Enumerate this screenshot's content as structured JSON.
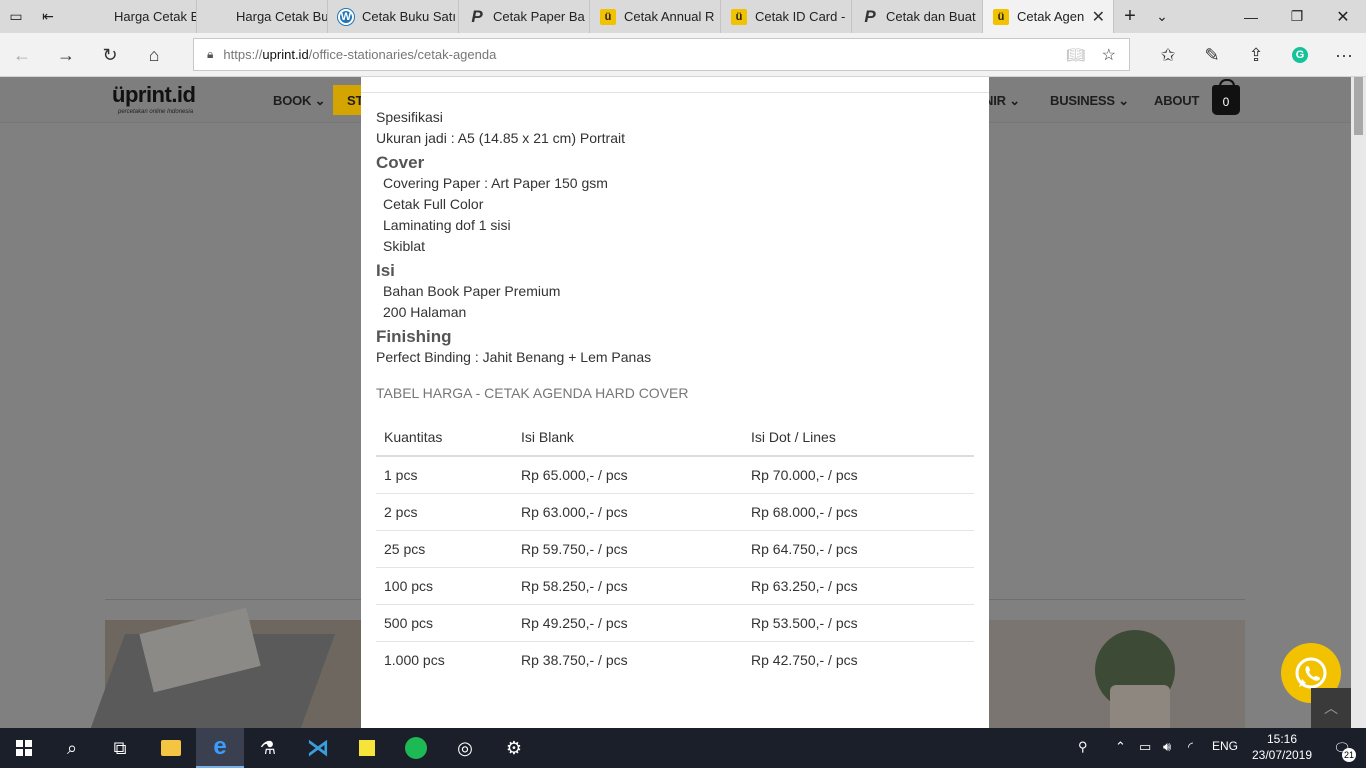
{
  "browser": {
    "tabs": [
      {
        "label": "Harga Cetak Bu",
        "favicon": "blank-icon"
      },
      {
        "label": "Harga Cetak Bu",
        "favicon": "blank-icon"
      },
      {
        "label": "Cetak Buku Satı",
        "favicon": "wordpress-icon"
      },
      {
        "label": "Cetak Paper Ba",
        "favicon": "p-icon"
      },
      {
        "label": "Cetak Annual R",
        "favicon": "uprint-icon"
      },
      {
        "label": "Cetak ID Card -",
        "favicon": "uprint-icon"
      },
      {
        "label": "Cetak dan Buat",
        "favicon": "p-icon"
      },
      {
        "label": "Cetak Agen",
        "favicon": "uprint-icon",
        "active": true
      }
    ],
    "url_prefix": "https://",
    "url_domain": "uprint.id",
    "url_path": "/office-stationaries/cetak-agenda"
  },
  "site": {
    "logo": "üprint.id",
    "tagline": "percetakan online Indonesia",
    "menu": {
      "book": "BOOK ⌄",
      "st": "ST",
      "nir": "NIR ⌄",
      "business": "BUSINESS ⌄",
      "about": "ABOUT"
    },
    "cart_count": "0"
  },
  "modal": {
    "spesifikasi": "Spesifikasi",
    "ukuran": "Ukuran jadi : A5 (14.85 x 21 cm) Portrait",
    "cover_heading": "Cover",
    "cover_items": [
      "Covering Paper : Art Paper 150 gsm",
      "Cetak Full Color",
      "Laminating dof 1 sisi",
      "Skiblat"
    ],
    "isi_heading": "Isi",
    "isi_items": [
      "Bahan Book Paper Premium",
      "200 Halaman"
    ],
    "finishing_heading": "Finishing",
    "finishing_text": "Perfect Binding : Jahit Benang + Lem Panas",
    "table_title": "TABEL HARGA - CETAK AGENDA HARD COVER",
    "table_headers": [
      "Kuantitas",
      "Isi Blank",
      "Isi Dot / Lines"
    ],
    "table_rows": [
      [
        "1 pcs",
        "Rp 65.000,- / pcs",
        "Rp 70.000,- / pcs"
      ],
      [
        "2 pcs",
        "Rp 63.000,- / pcs",
        "Rp 68.000,- / pcs"
      ],
      [
        "25 pcs",
        "Rp 59.750,- / pcs",
        "Rp 64.750,- / pcs"
      ],
      [
        "100 pcs",
        "Rp 58.250,- / pcs",
        "Rp 63.250,- / pcs"
      ],
      [
        "500 pcs",
        "Rp 49.250,- / pcs",
        "Rp 53.500,- / pcs"
      ],
      [
        "1.000 pcs",
        "Rp 38.750,- / pcs",
        "Rp 42.750,- / pcs"
      ]
    ]
  },
  "taskbar": {
    "lang": "ENG",
    "time": "15:16",
    "date": "23/07/2019",
    "notif_count": "21"
  },
  "colors": {
    "accent_yellow": "#f2c200",
    "overlay_gray": "#808080",
    "taskbar": "#1a1f2a"
  }
}
